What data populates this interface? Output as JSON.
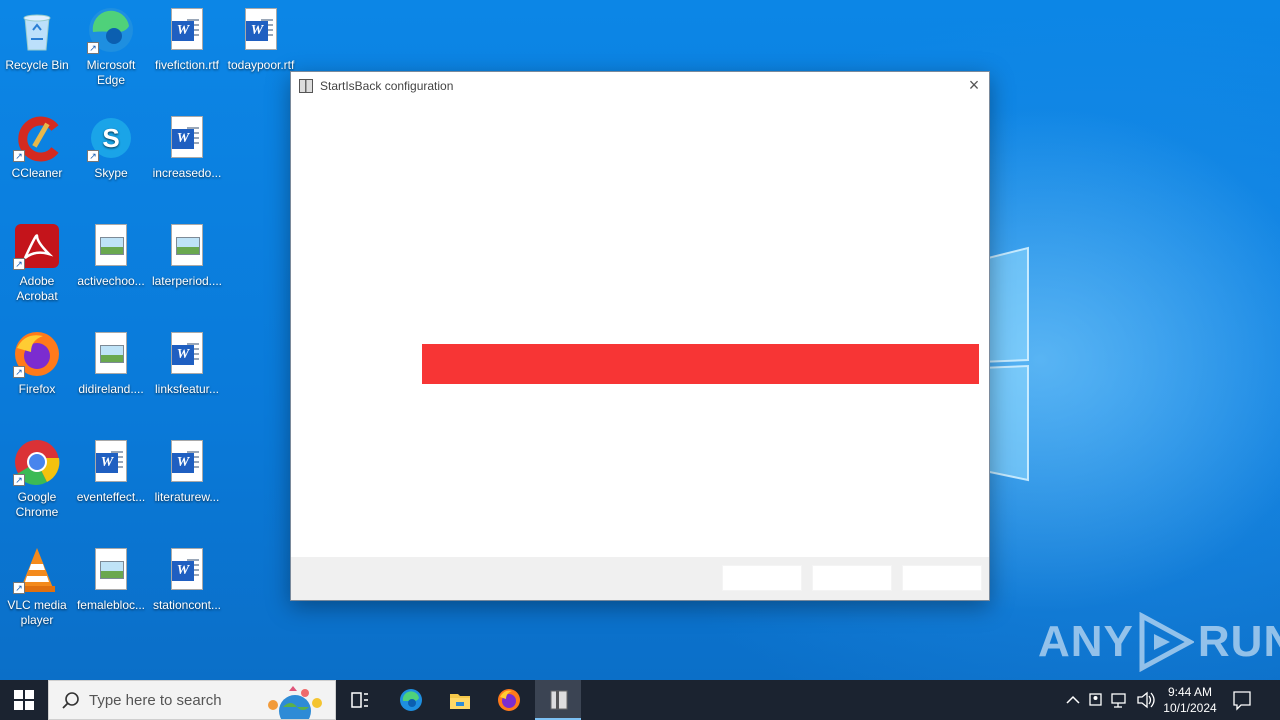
{
  "desktop": {
    "icons": [
      {
        "name": "recycle-bin",
        "label": "Recycle Bin",
        "type": "recycle"
      },
      {
        "name": "microsoft-edge",
        "label": "Microsoft Edge",
        "type": "edge"
      },
      {
        "name": "fivefiction-rtf",
        "label": "fivefiction.rtf",
        "type": "word"
      },
      {
        "name": "todaypoor-rtf",
        "label": "todaypoor.rtf",
        "type": "word"
      },
      {
        "name": "ccleaner",
        "label": "CCleaner",
        "type": "ccleaner"
      },
      {
        "name": "skype",
        "label": "Skype",
        "type": "skype"
      },
      {
        "name": "increasedo",
        "label": "increasedo...",
        "type": "word"
      },
      {
        "name": "adobe-acrobat",
        "label": "Adobe Acrobat",
        "type": "acrobat"
      },
      {
        "name": "activechoo",
        "label": "activechoo...",
        "type": "image"
      },
      {
        "name": "laterperiod",
        "label": "laterperiod....",
        "type": "image"
      },
      {
        "name": "firefox",
        "label": "Firefox",
        "type": "firefox"
      },
      {
        "name": "didireland",
        "label": "didireland....",
        "type": "image"
      },
      {
        "name": "linksfeatur",
        "label": "linksfeatur...",
        "type": "word"
      },
      {
        "name": "google-chrome",
        "label": "Google Chrome",
        "type": "chrome"
      },
      {
        "name": "eventeffect",
        "label": "eventeffect...",
        "type": "word"
      },
      {
        "name": "literaturew",
        "label": "literaturew...",
        "type": "word"
      },
      {
        "name": "vlc-media-player",
        "label": "VLC media player",
        "type": "vlc"
      },
      {
        "name": "femalebloc",
        "label": "femalebloc...",
        "type": "image"
      },
      {
        "name": "stationcont",
        "label": "stationcont...",
        "type": "word"
      }
    ]
  },
  "dialog": {
    "title": "StartIsBack configuration",
    "close_label": "×",
    "footer_buttons": [
      "",
      "",
      ""
    ]
  },
  "watermark": {
    "left": "ANY",
    "right": "RUN"
  },
  "taskbar": {
    "search_placeholder": "Type here to search",
    "apps": [
      "task-view",
      "edge",
      "file-explorer",
      "firefox",
      "startisback"
    ],
    "time": "9:44 AM",
    "date": "10/1/2024"
  }
}
